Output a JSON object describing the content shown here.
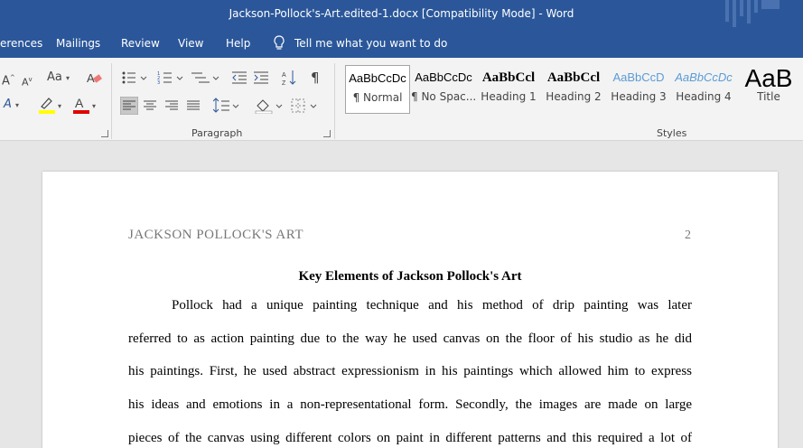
{
  "window": {
    "title": "Jackson-Pollock's-Art.edited-1.docx [Compatibility Mode]  -  Word"
  },
  "tabs": {
    "references": "erences",
    "mailings": "Mailings",
    "review": "Review",
    "view": "View",
    "help": "Help",
    "tell_me": "Tell me what you want to do"
  },
  "ribbon": {
    "font_group": {
      "grow": "A",
      "shrink": "A",
      "change_case": "Aa",
      "text_effects": "A",
      "font_color": "A",
      "highlight_color": "#ffff00",
      "font_color_value": "#e00000"
    },
    "paragraph_group": {
      "label": "Paragraph"
    },
    "styles_group": {
      "label": "Styles",
      "items": [
        {
          "sample": "AaBbCcDc",
          "name": "¶ Normal"
        },
        {
          "sample": "AaBbCcDc",
          "name": "¶ No Spac..."
        },
        {
          "sample": "AaBbCcl",
          "name": "Heading 1"
        },
        {
          "sample": "AaBbCcl",
          "name": "Heading 2"
        },
        {
          "sample": "AaBbCcD",
          "name": "Heading 3"
        },
        {
          "sample": "AaBbCcDc",
          "name": "Heading 4"
        },
        {
          "sample": "AaB",
          "name": "Title"
        }
      ]
    }
  },
  "document": {
    "header_title": "JACKSON POLLOCK'S ART",
    "page_number": "2",
    "heading": "Key Elements of Jackson Pollock's Art",
    "lines": [
      "Pollock had a unique painting technique and his method of drip painting was later",
      "referred to as action painting due to the way he used canvas on the floor of his studio as he did",
      "his paintings. First, he used abstract expressionism in his paintings which allowed him to express",
      "his ideas and emotions in a non-representational form. Secondly, the images are made on large",
      "pieces of the canvas using different colors on paint in different patterns and this required a lot of"
    ]
  },
  "colors": {
    "ribbon_blue": "#2b579a",
    "heading3_blue": "#5b9bd5"
  }
}
